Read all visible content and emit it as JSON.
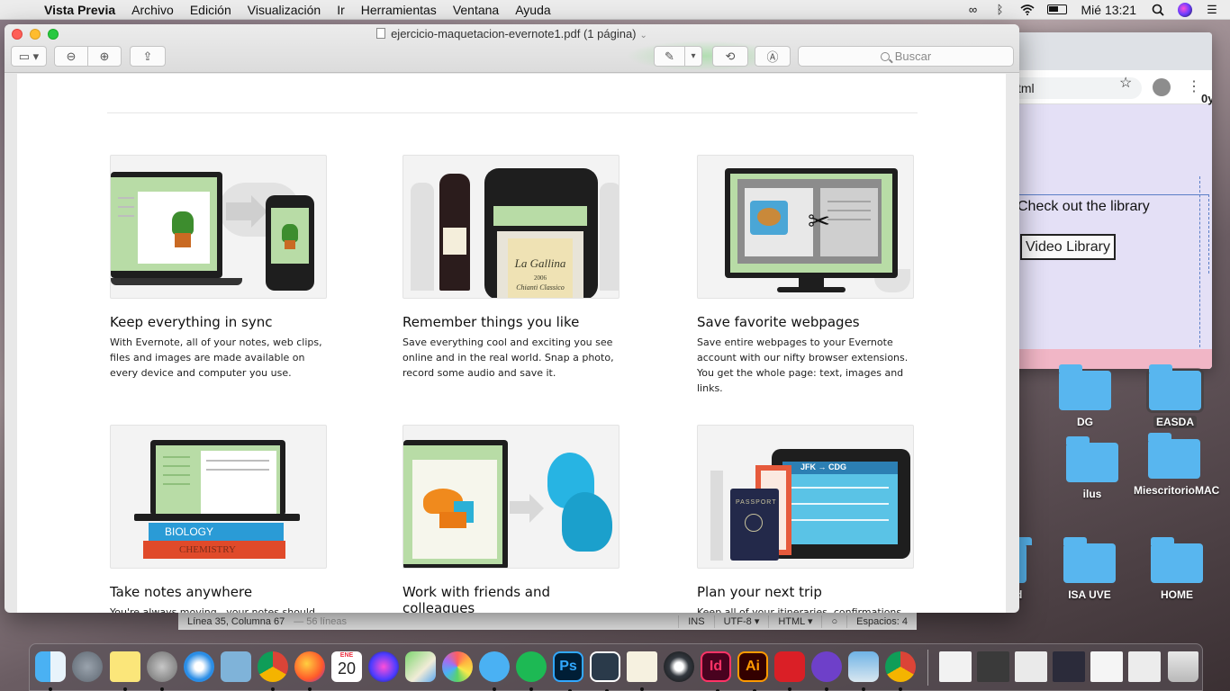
{
  "menubar": {
    "app_name": "Vista Previa",
    "items": [
      "Archivo",
      "Edición",
      "Visualización",
      "Ir",
      "Herramientas",
      "Ventana",
      "Ayuda"
    ],
    "clock": "Mié 13:21",
    "status_icons": [
      "creative-cloud-icon",
      "bluetooth-icon",
      "wifi-icon",
      "battery-icon",
      "search-icon",
      "siri-icon",
      "list-icon"
    ]
  },
  "preview": {
    "title": "ejercicio-maquetacion-evernote1.pdf (1 página)",
    "search_placeholder": "Buscar",
    "features": [
      {
        "title": "Keep everything in sync",
        "text": "With Evernote, all of your notes, web clips, files and images are made available on every device and computer you use."
      },
      {
        "title": "Remember things you like",
        "text": "Save everything cool and exciting you see online and in the real world. Snap a photo, record some audio and save it."
      },
      {
        "title": "Save favorite webpages",
        "text": "Save entire webpages to your Evernote account with our nifty browser extensions. You get the whole page: text, images and links."
      },
      {
        "title": "Take notes anywhere",
        "text": "You're always moving , your notes should"
      },
      {
        "title": "Work with friends and colleagues",
        "text": ""
      },
      {
        "title": "Plan your next trip",
        "text": "Keep all of your itineraries, confirmations"
      }
    ],
    "illustrations": {
      "book1": "BIOLOGY",
      "book2": "CHEMISTRY",
      "wine_label": "La Gallina",
      "wine_label_sub": "Chianti Classico",
      "wine_year": "2006",
      "flight": "JFK → CDG",
      "passport": "PASSPORT"
    }
  },
  "background_browser": {
    "url_fragment": "tml",
    "edge_text": "0y",
    "section_text": "Check out the library",
    "button_label": "Video Library"
  },
  "editor_status": {
    "position": "Línea 35, Columna 67",
    "lines": "— 56 líneas",
    "mode": "INS",
    "encoding": "UTF-8",
    "syntax": "HTML",
    "indent": "Espacios: 4"
  },
  "desktop_folders": [
    {
      "label": "DG"
    },
    {
      "label": "EASDA"
    },
    {
      "label": "ilus"
    },
    {
      "label": "MiescritorioMAC"
    },
    {
      "label": "id"
    },
    {
      "label": "ISA UVE"
    },
    {
      "label": "HOME"
    }
  ],
  "dock": {
    "calendar_month": "ENE",
    "calendar_day": "20",
    "ps": "Ps",
    "id": "Id",
    "ai": "Ai",
    "apps": [
      "finder-icon",
      "launchpad-icon",
      "notes-icon",
      "system-preferences-icon",
      "safari-icon",
      "mail-icon",
      "chrome-icon",
      "firefox-icon",
      "calendar-icon",
      "siri-icon",
      "maps-icon",
      "photos-icon",
      "messages-icon",
      "spotify-icon",
      "photoshop-icon",
      "brackets-icon",
      "textedit-icon",
      "cinema4d-icon",
      "indesign-icon",
      "illustrator-icon",
      "creative-cloud-icon",
      "github-icon",
      "preview-icon",
      "chrome-icon",
      "trash-icon"
    ]
  }
}
